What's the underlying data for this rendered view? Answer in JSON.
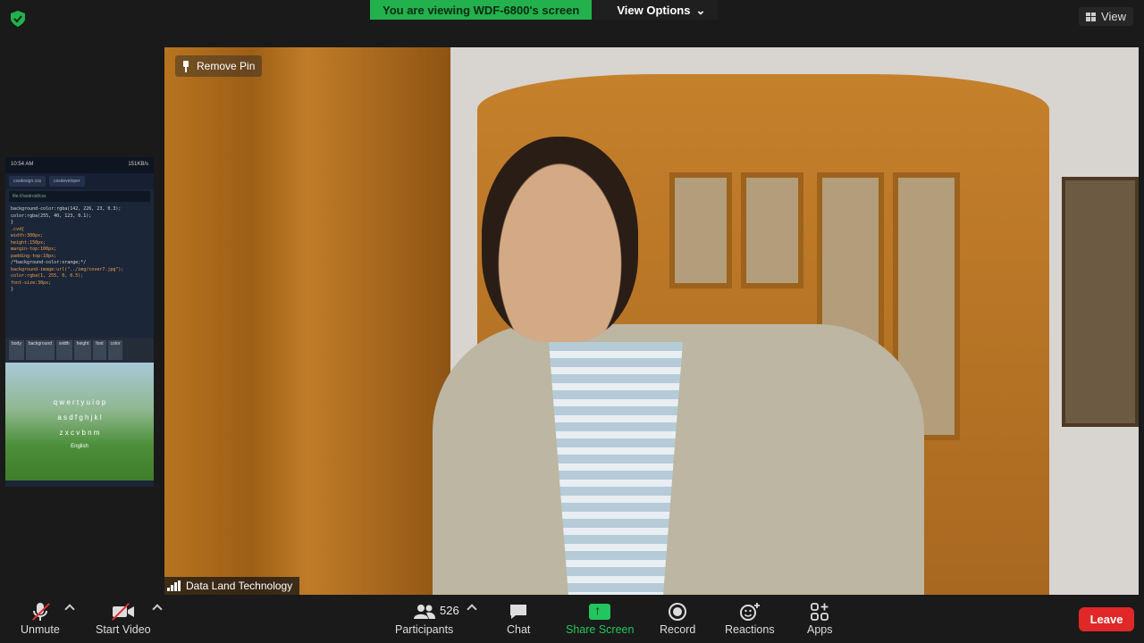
{
  "topbar": {
    "viewing_text": "You are viewing WDF-6800's screen",
    "view_options_label": "View Options",
    "view_label": "View"
  },
  "main": {
    "remove_pin_label": "Remove Pin",
    "participant_name": "Data Land Technology"
  },
  "thumbnail": {
    "time": "10:54 AM",
    "status": "151KB/s",
    "tabs": [
      "cssdesign.css",
      "cssdeveloper"
    ],
    "url": "file:///android/css",
    "code_lines": [
      "background-color:rgba(142, 226, 23, 0.3);",
      "color:rgba(255, 40, 123, 0.1);",
      "}",
      ".cvd{",
      "width:300px;",
      "height:150px;",
      "margin-top:100px;",
      "padding-top:10px;",
      "/*background-color:orange;*/",
      "background-image:url(\"../img/cover7.jpg\");",
      "color:rgba(1, 255, 0, 0.5);",
      "font-size:30px;",
      "}"
    ],
    "keys": [
      "body",
      "background",
      "width",
      "height",
      "font",
      "color"
    ],
    "keyboard_rows": [
      "q w e r t y u i o p",
      "a s d f g h j k l",
      "z x c v b n m"
    ],
    "keyboard_language": "English"
  },
  "toolbar": {
    "unmute_label": "Unmute",
    "start_video_label": "Start Video",
    "participants_label": "Participants",
    "participants_count": "526",
    "chat_label": "Chat",
    "share_screen_label": "Share Screen",
    "record_label": "Record",
    "reactions_label": "Reactions",
    "apps_label": "Apps",
    "leave_label": "Leave"
  },
  "colors": {
    "share_green": "#22c55e",
    "leave_red": "#e02828",
    "banner_green": "#22b14c"
  }
}
